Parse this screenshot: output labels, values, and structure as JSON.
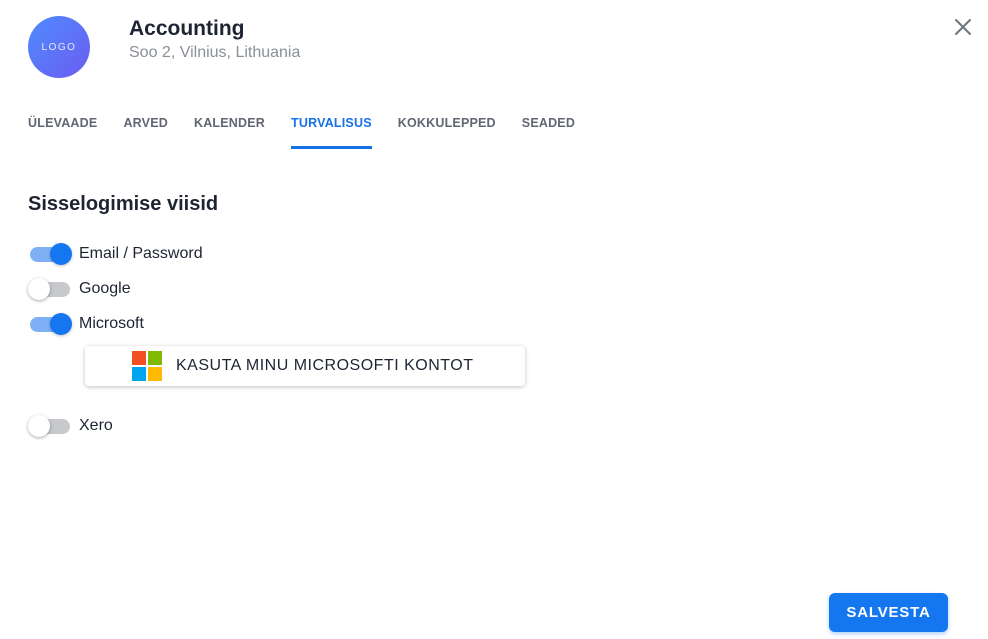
{
  "header": {
    "logo_text": "LOGO",
    "title": "Accounting",
    "address": "Soo 2, Vilnius, Lithuania"
  },
  "tabs": [
    {
      "label": "ÜLEVAADE",
      "active": false
    },
    {
      "label": "ARVED",
      "active": false
    },
    {
      "label": "KALENDER",
      "active": false
    },
    {
      "label": "TURVALISUS",
      "active": true
    },
    {
      "label": "KOKKULEPPED",
      "active": false
    },
    {
      "label": "SEADED",
      "active": false
    }
  ],
  "section": {
    "title": "Sisselogimise viisid"
  },
  "login_methods": [
    {
      "label": "Email / Password",
      "enabled": true
    },
    {
      "label": "Google",
      "enabled": false
    },
    {
      "label": "Microsoft",
      "enabled": true
    },
    {
      "label": "Xero",
      "enabled": false
    }
  ],
  "microsoft_button": {
    "label": "KASUTA MINU MICROSOFTI KONTOT",
    "icon": "microsoft-logo-icon",
    "logo_colors": [
      "#f25022",
      "#7fba00",
      "#00a4ef",
      "#ffb900"
    ]
  },
  "footer": {
    "save_label": "SALVESTA"
  },
  "colors": {
    "accent": "#1577f0",
    "tab_active": "#1670e8",
    "switch_on_track": "#7fb0f5",
    "switch_off_track": "#c7c9cc"
  },
  "icons": {
    "close": "close-icon"
  }
}
